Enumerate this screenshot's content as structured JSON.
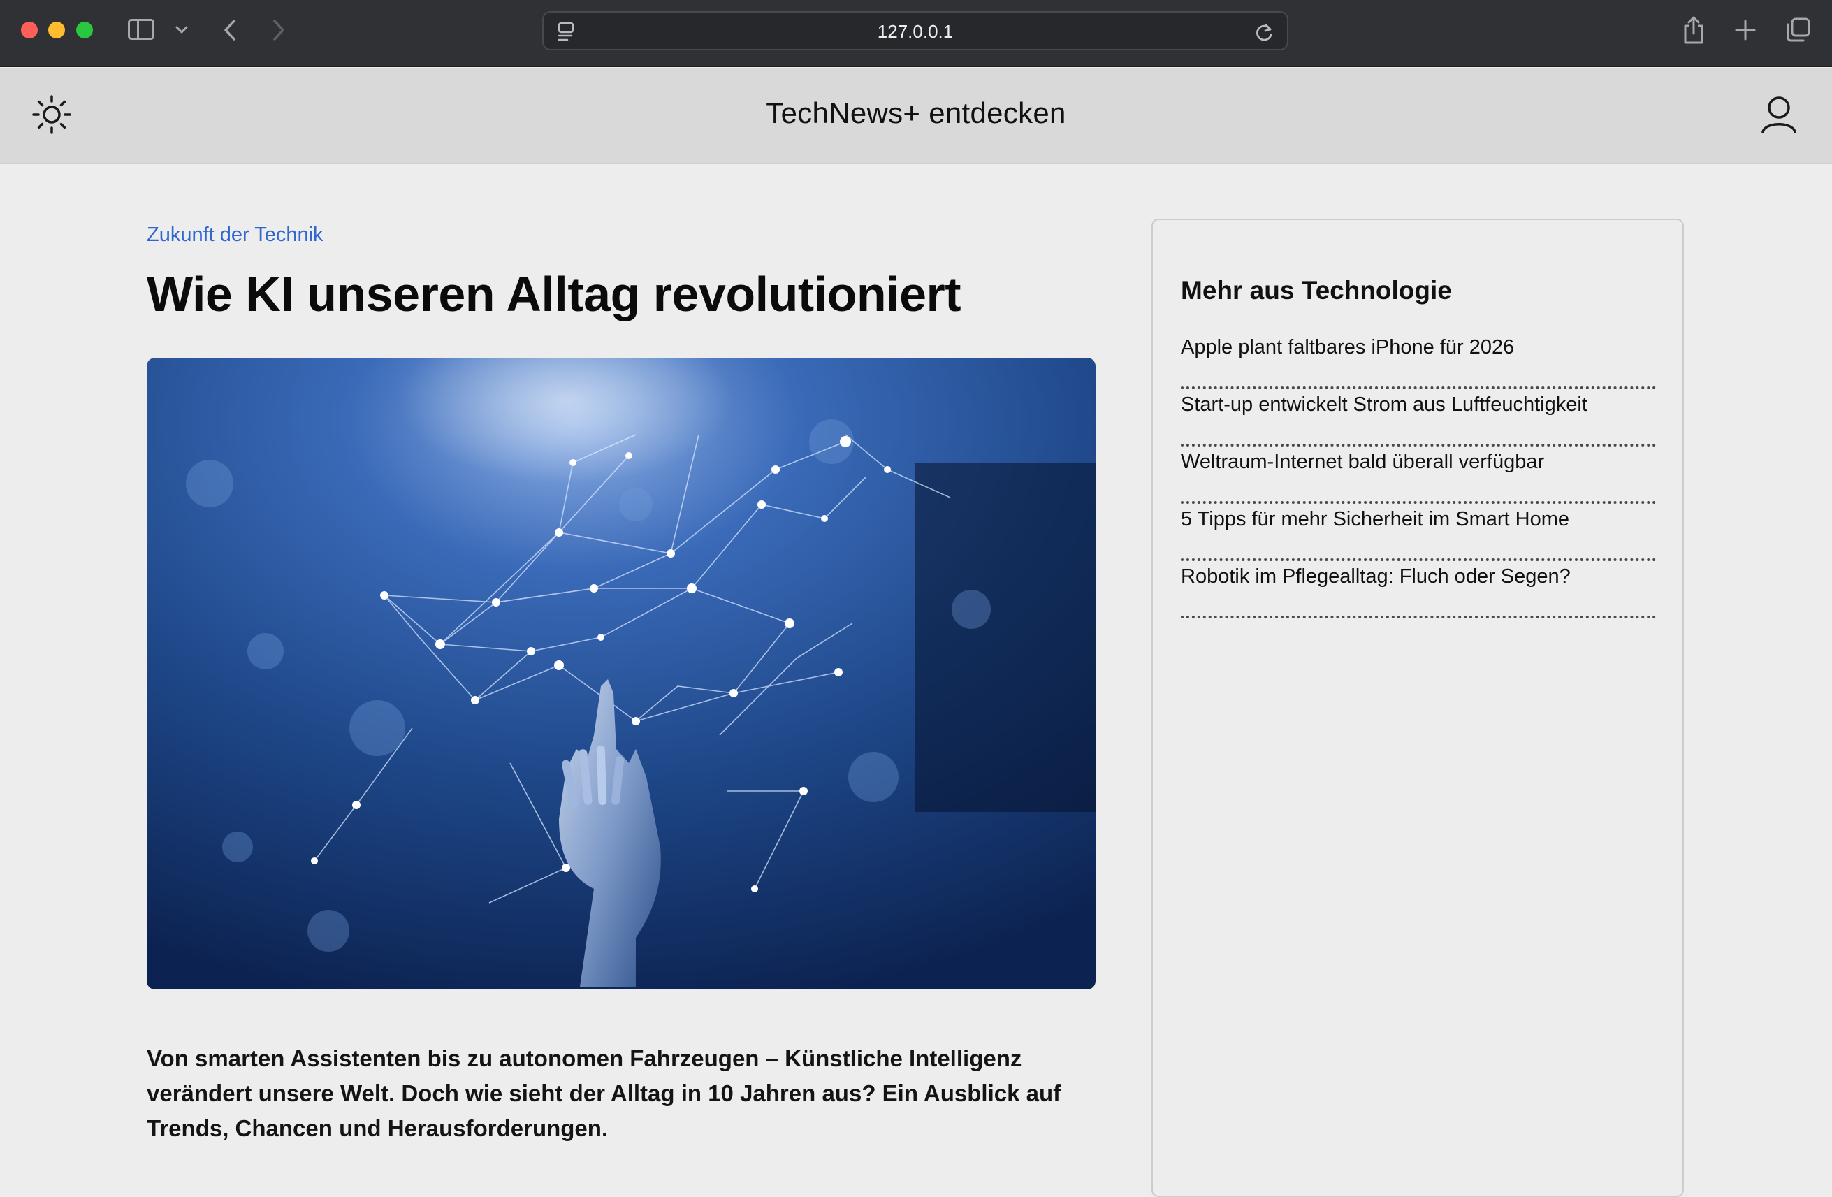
{
  "browser": {
    "url": "127.0.0.1",
    "icons": {
      "sidebar": "sidebar-icon",
      "chevron": "chevron-down-icon",
      "back": "chevron-left-icon",
      "forward": "chevron-right-icon",
      "reader": "reader-icon",
      "reload": "reload-icon",
      "share": "share-icon",
      "new_tab": "plus-icon",
      "tabs": "tabs-overview-icon"
    }
  },
  "header": {
    "title": "TechNews+ entdecken",
    "theme_icon": "sun-icon",
    "user_icon": "user-icon"
  },
  "article": {
    "category": "Zukunft der Technik",
    "headline": "Wie KI unseren Alltag revolutioniert",
    "lead": "Von smarten Assistenten bis zu autonomen Fahrzeugen – Künstliche Intelligenz verändert unsere Welt. Doch wie sieht der Alltag in 10 Jahren aus? Ein Ausblick auf Trends, Chancen und Herausforderungen."
  },
  "sidebar": {
    "title": "Mehr aus Technologie",
    "items": [
      {
        "label": "Apple plant faltbares iPhone für 2026"
      },
      {
        "label": "Start-up entwickelt Strom aus Luftfeuchtigkeit"
      },
      {
        "label": "Weltraum-Internet bald überall verfügbar"
      },
      {
        "label": "5 Tipps für mehr Sicherheit im Smart Home"
      },
      {
        "label": "Robotik im Pflegealltag: Fluch oder Segen?"
      }
    ]
  },
  "colors": {
    "accent": "#2f66d0",
    "chrome": "#2f3134",
    "header_bg": "#d9d9d9",
    "page_bg": "#ededed"
  }
}
